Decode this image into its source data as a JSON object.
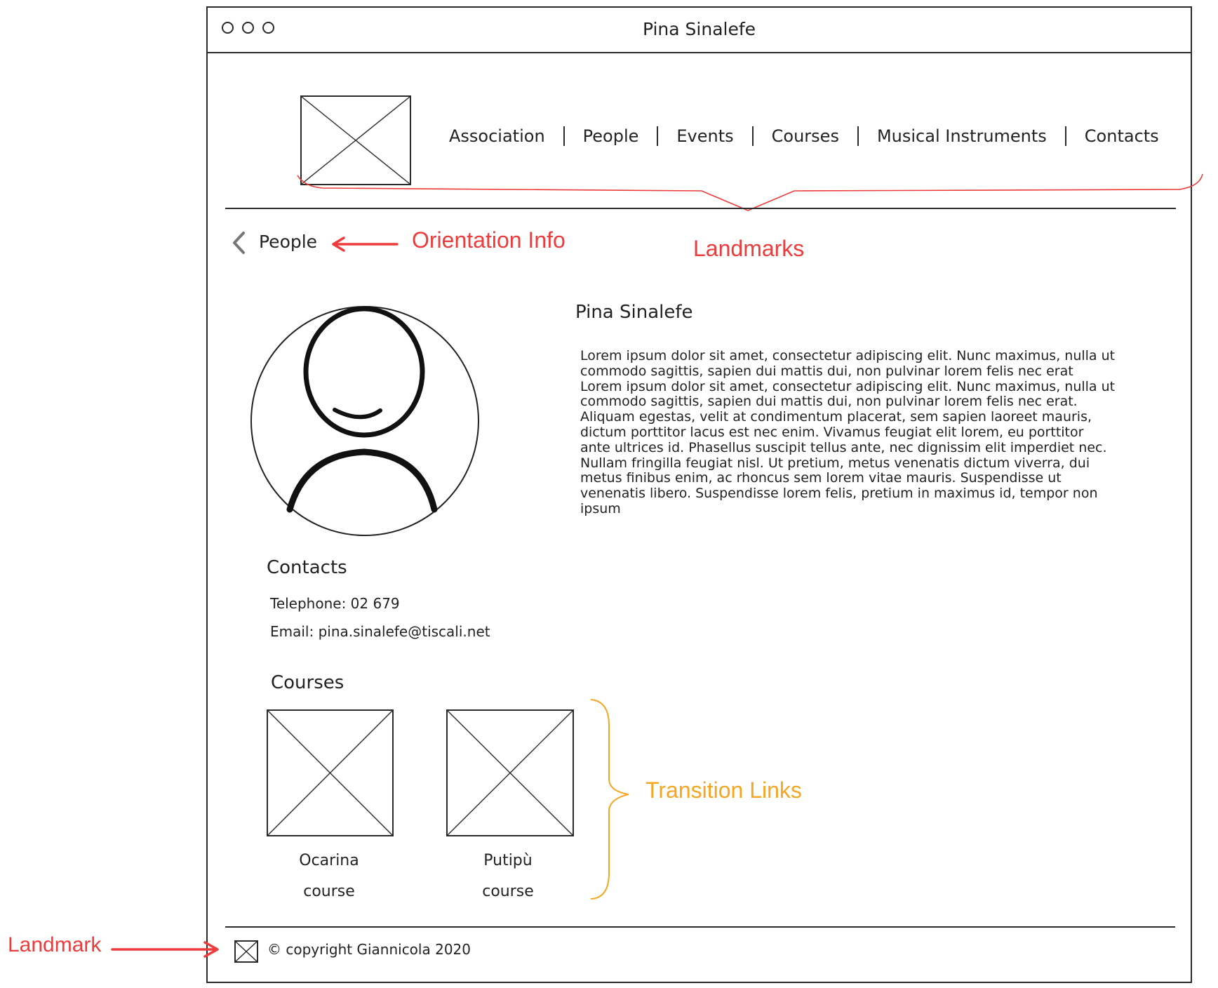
{
  "window": {
    "title": "Pina Sinalefe"
  },
  "nav": {
    "items": [
      "Association",
      "People",
      "Events",
      "Courses",
      "Musical Instruments",
      "Contacts"
    ]
  },
  "breadcrumb": {
    "label": "People"
  },
  "profile": {
    "name": "Pina Sinalefe",
    "bio": "Lorem ipsum dolor sit amet, consectetur adipiscing elit. Nunc maximus, nulla ut commodo sagittis, sapien dui mattis dui, non pulvinar lorem felis nec erat Lorem ipsum dolor sit amet, consectetur adipiscing elit. Nunc maximus, nulla ut commodo sagittis, sapien dui mattis dui, non pulvinar lorem felis nec erat. Aliquam egestas, velit at condimentum placerat, sem sapien laoreet mauris, dictum porttitor lacus est nec enim. Vivamus feugiat elit lorem, eu porttitor ante ultrices id. Phasellus suscipit tellus ante, nec dignissim elit imperdiet nec. Nullam fringilla feugiat nisl. Ut pretium, metus venenatis dictum viverra, dui metus finibus enim, ac rhoncus sem lorem vitae mauris. Suspendisse ut venenatis libero. Suspendisse lorem felis, pretium in maximus id, tempor non ipsum"
  },
  "contacts": {
    "heading": "Contacts",
    "telephone": "Telephone: 02 679",
    "email": "Email: pina.sinalefe@tiscali.net"
  },
  "courses": {
    "heading": "Courses",
    "items": [
      {
        "line1": "Ocarina",
        "line2": "course"
      },
      {
        "line1": "Putipù",
        "line2": "course"
      }
    ]
  },
  "footer": {
    "copyright": "© copyright Giannicola 2020"
  },
  "annotations": {
    "orientation_info": "Orientation Info",
    "landmarks": "Landmarks",
    "transition_links": "Transition Links",
    "landmark": "Landmark"
  },
  "colors": {
    "annotation_red": "#ee3b3b",
    "annotation_orange": "#f6a623",
    "sketch_line": "#2b2b2b"
  }
}
